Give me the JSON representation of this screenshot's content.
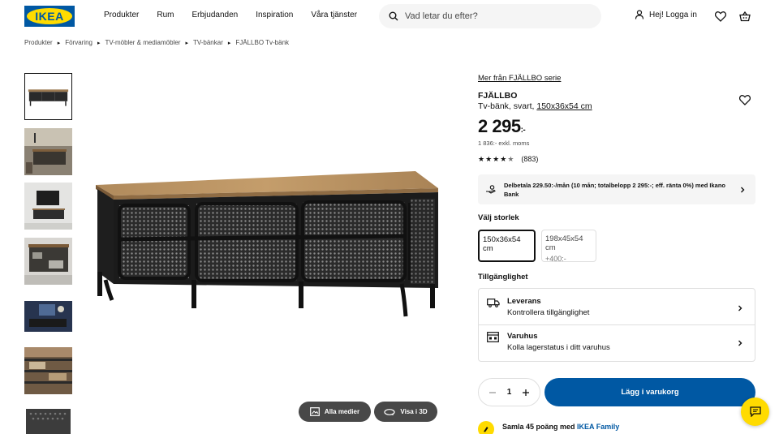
{
  "header": {
    "logo_text": "IKEA",
    "nav": [
      "Produkter",
      "Rum",
      "Erbjudanden",
      "Inspiration",
      "Våra tjänster"
    ],
    "search_placeholder": "Vad letar du efter?",
    "login_label": "Hej! Logga in",
    "icons": [
      "search-icon",
      "user-icon",
      "heart-icon",
      "cart-icon"
    ]
  },
  "breadcrumb": [
    "Produkter",
    "Förvaring",
    "TV-möbler & mediamöbler",
    "TV-bänkar",
    "FJÄLLBO Tv-bänk"
  ],
  "gallery": {
    "thumbnail_count": 7,
    "all_media_label": "Alla medier",
    "view_3d_label": "Visa i 3D"
  },
  "product": {
    "series_link": "Mer från FJÄLLBO serie",
    "name": "FJÄLLBO",
    "desc_prefix": "Tv-bänk, svart,",
    "size_link": "150x36x54 cm",
    "price": "2 295",
    "price_suffix": ":-",
    "price_ex_vat": "1 836:- exkl. moms",
    "rating_stars": 4.5,
    "rating_count": "(883)",
    "finance_text": "Delbetala 229.50:-/mån (10 mån; totalbelopp 2 295:-; eff. ränta 0%) med Ikano Bank"
  },
  "size": {
    "title": "Välj storlek",
    "options": [
      {
        "label": "150x36x54 cm",
        "extra": ""
      },
      {
        "label": "198x45x54 cm",
        "extra": "+400:-"
      }
    ]
  },
  "availability": {
    "title": "Tillgänglighet",
    "delivery_label": "Leverans",
    "delivery_sub": "Kontrollera tillgänglighet",
    "store_label": "Varuhus",
    "store_sub": "Kolla lagerstatus i ditt varuhus"
  },
  "cart": {
    "quantity": "1",
    "add_label": "Lägg i varukorg"
  },
  "family": {
    "prefix": "Samla 45 poäng med",
    "link": "IKEA Family"
  },
  "colors": {
    "brand_blue": "#0058a3",
    "brand_yellow": "#ffdb00"
  }
}
